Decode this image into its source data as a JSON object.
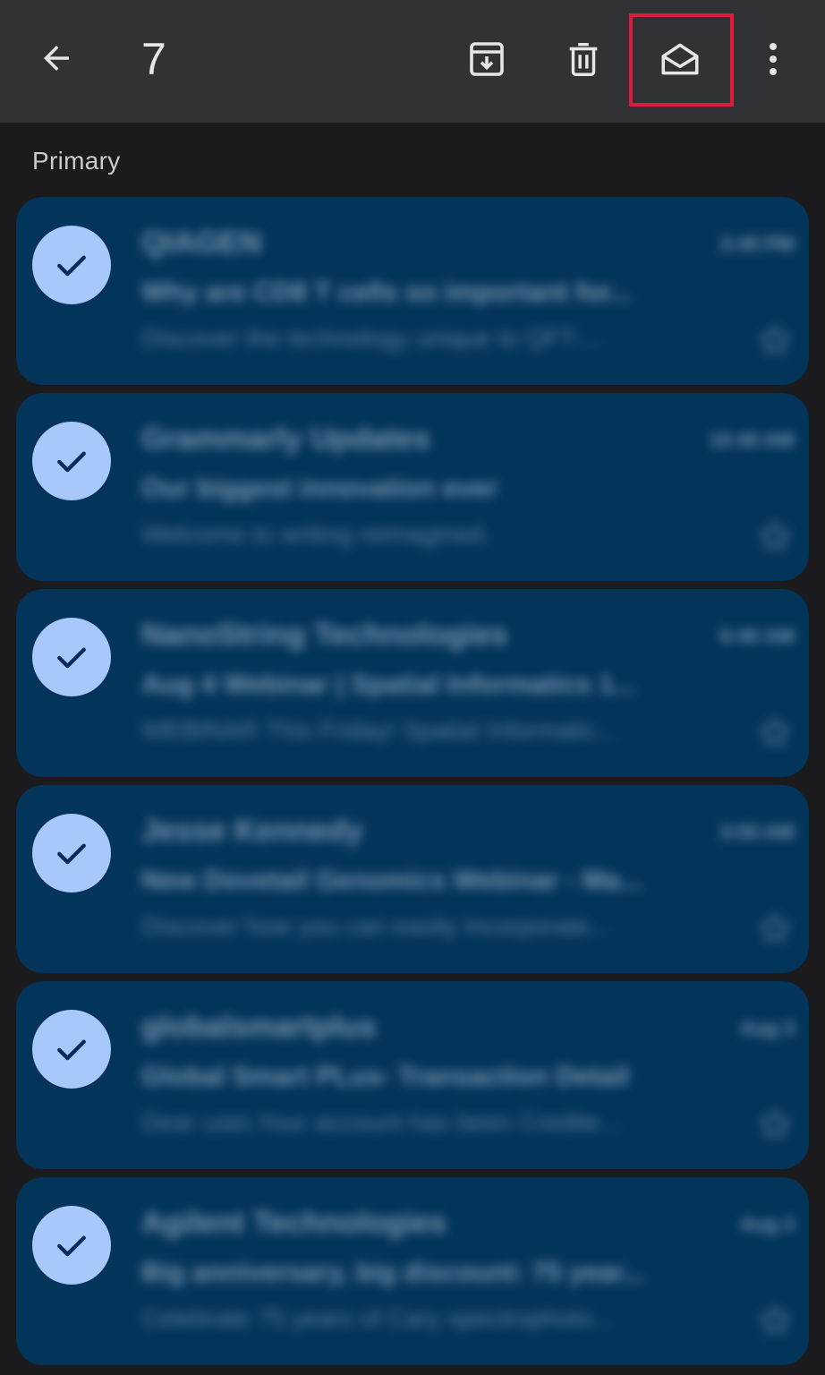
{
  "toolbar": {
    "back_icon": "arrow-left-icon",
    "selected_count": "7",
    "actions": [
      {
        "name": "archive",
        "icon": "archive-icon"
      },
      {
        "name": "delete",
        "icon": "trash-icon"
      },
      {
        "name": "mark-as-read",
        "icon": "envelope-open-icon"
      },
      {
        "name": "more",
        "icon": "more-vert-icon"
      }
    ],
    "highlight_color": "#e01a3c"
  },
  "section": {
    "label": "Primary"
  },
  "colors": {
    "toolbar_bg": "#313236",
    "page_bg": "#1b1b1d",
    "selected_row_bg": "#03345a",
    "check_avatar_bg": "#a8c7fa",
    "check_color": "#0b2a5c"
  },
  "emails": [
    {
      "sender": "QIAGEN",
      "time": "2:40 PM",
      "subject": "Why are CD8 T cells so important for...",
      "snippet": "Discover the technology unique to QFT-...",
      "selected": true
    },
    {
      "sender": "Grammarly Updates",
      "time": "10:40 AM",
      "subject": "Our biggest innovation ever",
      "snippet": "Welcome to writing reimagined.",
      "selected": true
    },
    {
      "sender": "NanoString Technologies",
      "time": "6:40 AM",
      "subject": "Aug 4 Webinar | Spatial Informatics 1...",
      "snippet": "WEBINAR This Friday! Spatial Informatic...",
      "selected": true
    },
    {
      "sender": "Jesse Kennedy",
      "time": "3:00 AM",
      "subject": "New Dovetail Genomics Webinar - Ma...",
      "snippet": "Discover how you can easily incorporate...",
      "selected": true
    },
    {
      "sender": "globalsmartplus",
      "time": "Aug 3",
      "subject": "Global Smart PLus- Transaction Detail",
      "snippet": "Dear user,Your account has been Credite...",
      "selected": true
    },
    {
      "sender": "Agilent Technologies",
      "time": "Aug 3",
      "subject": "Big anniversary, big discount: 75 year...",
      "snippet": "Celebrate 75 years of Cary spectrophoto...",
      "selected": true
    }
  ]
}
